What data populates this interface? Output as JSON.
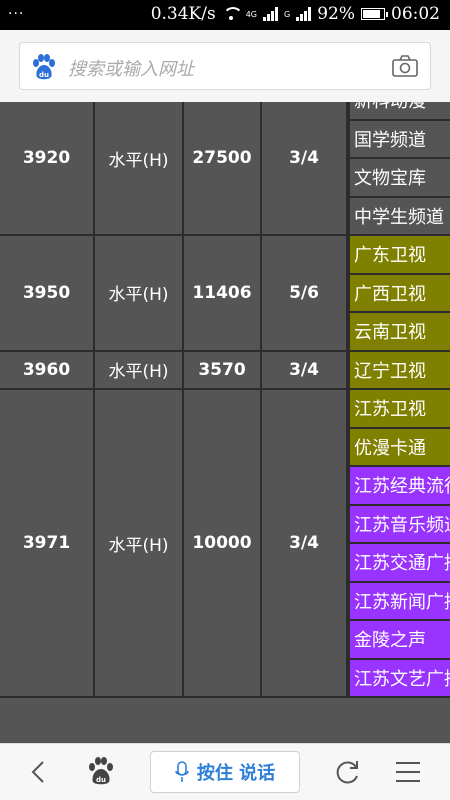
{
  "status_bar": {
    "left_indicator": "···",
    "speed": "0.34K/s",
    "net1": "4G",
    "net2": "G",
    "battery": "92%",
    "battery_level": 0.92,
    "time": "06:02"
  },
  "search": {
    "placeholder": "搜索或输入网址"
  },
  "voice_button": {
    "label": "按住 说话"
  },
  "colors": {
    "grey_cell": "#555555",
    "olive": "#808000",
    "purple": "#9933ff",
    "accent": "#2d7fd8"
  },
  "table": {
    "rows": [
      {
        "freq": "3920",
        "polarization": "水平(H)",
        "symbol_rate": "27500",
        "fec": "3/4",
        "channels": [
          {
            "name": "新科动漫",
            "color": "grey"
          },
          {
            "name": "国学频道",
            "color": "grey"
          },
          {
            "name": "文物宝库",
            "color": "grey"
          },
          {
            "name": "中学生频道",
            "color": "grey"
          }
        ]
      },
      {
        "freq": "3950",
        "polarization": "水平(H)",
        "symbol_rate": "11406",
        "fec": "5/6",
        "channels": [
          {
            "name": "广东卫视",
            "color": "olive"
          },
          {
            "name": "广西卫视",
            "color": "olive"
          },
          {
            "name": "云南卫视",
            "color": "olive"
          }
        ]
      },
      {
        "freq": "3960",
        "polarization": "水平(H)",
        "symbol_rate": "3570",
        "fec": "3/4",
        "channels": [
          {
            "name": "辽宁卫视",
            "color": "olive"
          }
        ]
      },
      {
        "freq": "3971",
        "polarization": "水平(H)",
        "symbol_rate": "10000",
        "fec": "3/4",
        "channels": [
          {
            "name": "江苏卫视",
            "color": "olive"
          },
          {
            "name": "优漫卡通",
            "color": "olive"
          },
          {
            "name": "江苏经典流行",
            "color": "purple"
          },
          {
            "name": "江苏音乐频道",
            "color": "purple"
          },
          {
            "name": "江苏交通广播",
            "color": "purple"
          },
          {
            "name": "江苏新闻广播",
            "color": "purple"
          },
          {
            "name": "金陵之声",
            "color": "purple"
          },
          {
            "name": "江苏文艺广播",
            "color": "purple"
          }
        ]
      }
    ]
  }
}
